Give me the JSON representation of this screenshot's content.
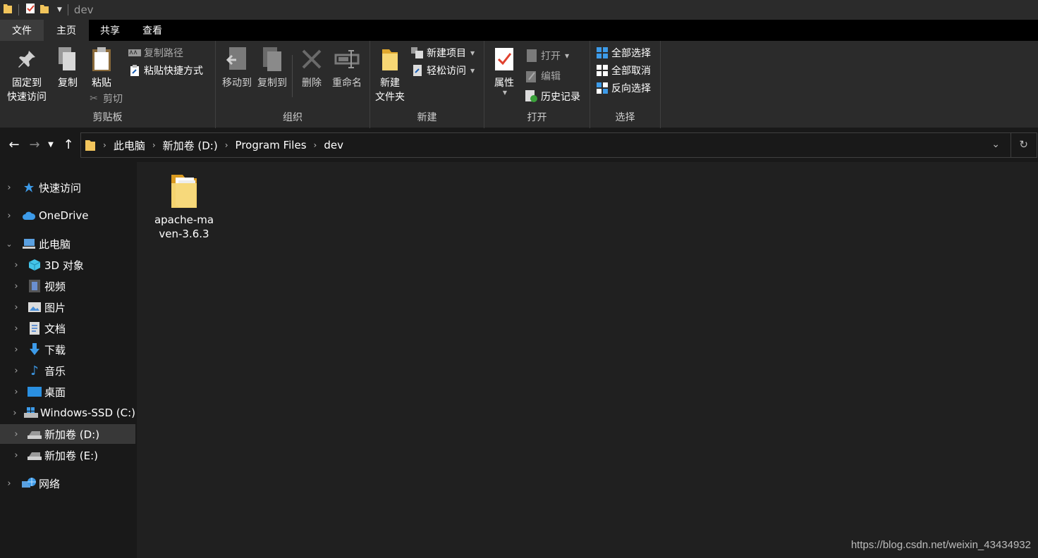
{
  "window": {
    "title": "dev"
  },
  "tabs": [
    "文件",
    "主页",
    "共享",
    "查看"
  ],
  "ribbon": {
    "clipboard": {
      "label": "剪贴板",
      "pin_l1": "固定到",
      "pin_l2": "快速访问",
      "copy": "复制",
      "paste": "粘贴",
      "copy_path": "复制路径",
      "paste_shortcut": "粘贴快捷方式",
      "cut": "剪切"
    },
    "organize": {
      "label": "组织",
      "move_to": "移动到",
      "copy_to": "复制到",
      "delete": "删除",
      "rename": "重命名"
    },
    "new": {
      "label": "新建",
      "new_folder_l1": "新建",
      "new_folder_l2": "文件夹",
      "new_item": "新建项目",
      "easy_access": "轻松访问"
    },
    "open": {
      "label": "打开",
      "properties": "属性",
      "open": "打开",
      "edit": "编辑",
      "history": "历史记录"
    },
    "select": {
      "label": "选择",
      "select_all": "全部选择",
      "select_none": "全部取消",
      "invert": "反向选择"
    }
  },
  "address": {
    "crumbs": [
      "此电脑",
      "新加卷 (D:)",
      "Program Files",
      "dev"
    ]
  },
  "sidebar": {
    "items": [
      {
        "label": "快速访问",
        "icon": "star-icon"
      },
      {
        "label": "OneDrive",
        "icon": "cloud-icon"
      },
      {
        "label": "此电脑",
        "icon": "computer-icon"
      },
      {
        "label": "3D 对象",
        "icon": "cube-icon"
      },
      {
        "label": "视频",
        "icon": "film-icon"
      },
      {
        "label": "图片",
        "icon": "picture-icon"
      },
      {
        "label": "文档",
        "icon": "document-icon"
      },
      {
        "label": "下载",
        "icon": "download-icon"
      },
      {
        "label": "音乐",
        "icon": "music-icon"
      },
      {
        "label": "桌面",
        "icon": "desktop-icon"
      },
      {
        "label": "Windows-SSD (C:)",
        "icon": "windows-drive-icon"
      },
      {
        "label": "新加卷 (D:)",
        "icon": "drive-icon"
      },
      {
        "label": "新加卷 (E:)",
        "icon": "drive-icon"
      },
      {
        "label": "网络",
        "icon": "network-icon"
      }
    ]
  },
  "content": {
    "files": [
      {
        "name": "apache-maven-3.6.3",
        "type": "folder"
      }
    ]
  },
  "watermark": "https://blog.csdn.net/weixin_43434932",
  "colors": {
    "background": "#191919",
    "content": "#202020",
    "ribbon": "#2b2b2b",
    "accent": "#0078d7",
    "folder": "#f2c55c"
  }
}
